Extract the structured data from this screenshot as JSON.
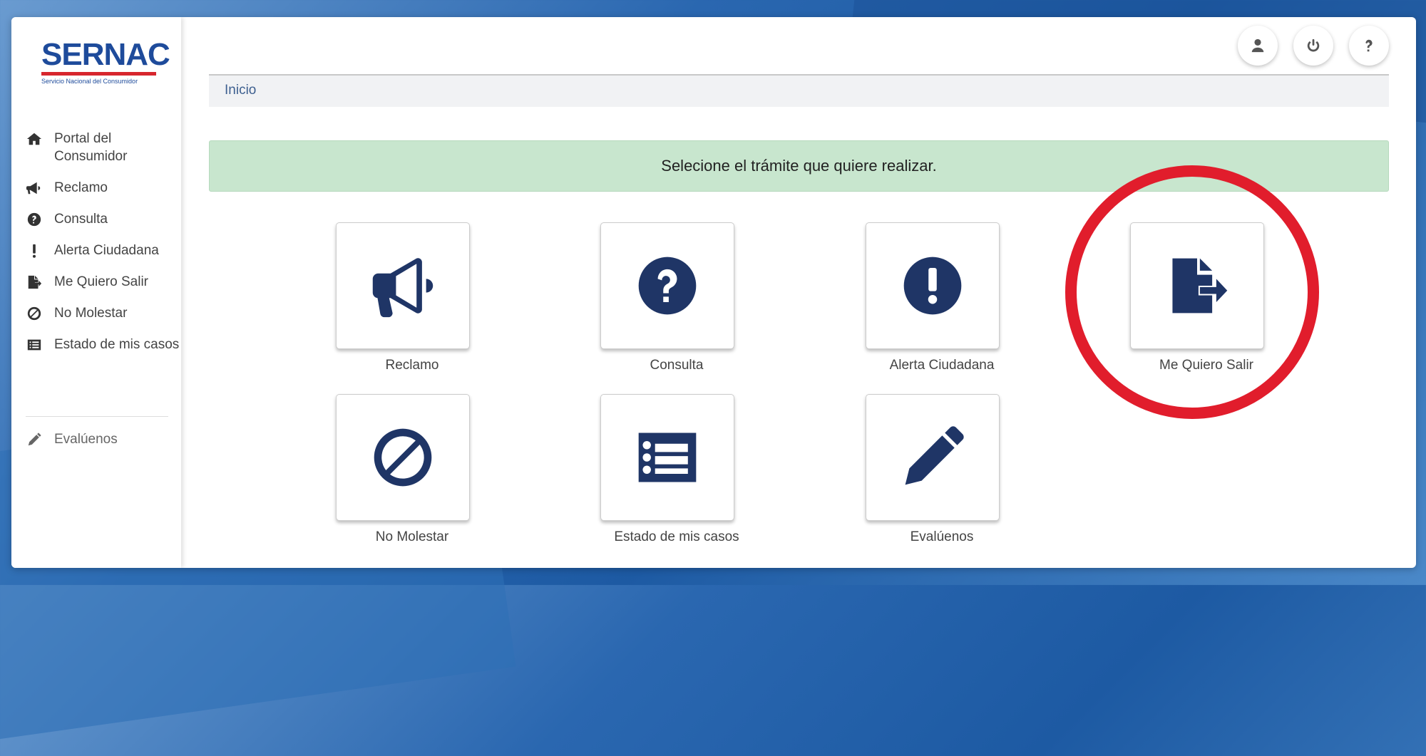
{
  "logo": {
    "name": "SERNAC",
    "subtitle": "Servicio Nacional del Consumidor"
  },
  "sidebar": {
    "items": [
      {
        "label": "Portal del Consumidor",
        "icon": "home-icon"
      },
      {
        "label": "Reclamo",
        "icon": "megaphone-icon"
      },
      {
        "label": "Consulta",
        "icon": "question-circle-icon"
      },
      {
        "label": "Alerta Ciudadana",
        "icon": "exclamation-icon"
      },
      {
        "label": "Me Quiero Salir",
        "icon": "file-export-icon"
      },
      {
        "label": "No Molestar",
        "icon": "ban-icon"
      },
      {
        "label": "Estado de mis casos",
        "icon": "list-alt-icon"
      }
    ],
    "eval_label": "Evalúenos"
  },
  "header": {
    "buttons": [
      "user-icon",
      "power-icon",
      "help-icon"
    ]
  },
  "breadcrumb": {
    "label": "Inicio"
  },
  "alert": {
    "text": "Selecione el trámite que quiere realizar."
  },
  "tiles": [
    {
      "label": "Reclamo",
      "icon": "megaphone-icon"
    },
    {
      "label": "Consulta",
      "icon": "question-circle-icon"
    },
    {
      "label": "Alerta Ciudadana",
      "icon": "exclamation-circle-icon"
    },
    {
      "label": "Me Quiero Salir",
      "icon": "file-export-icon"
    },
    {
      "label": "No Molestar",
      "icon": "ban-icon"
    },
    {
      "label": "Estado de mis casos",
      "icon": "list-alt-icon"
    },
    {
      "label": "Evalúenos",
      "icon": "pencil-icon"
    }
  ],
  "colors": {
    "brand": "#1e4b9b",
    "tile_icon": "#1f3566",
    "alert_bg": "#c8e6ce",
    "highlight": "#e11d2c"
  }
}
